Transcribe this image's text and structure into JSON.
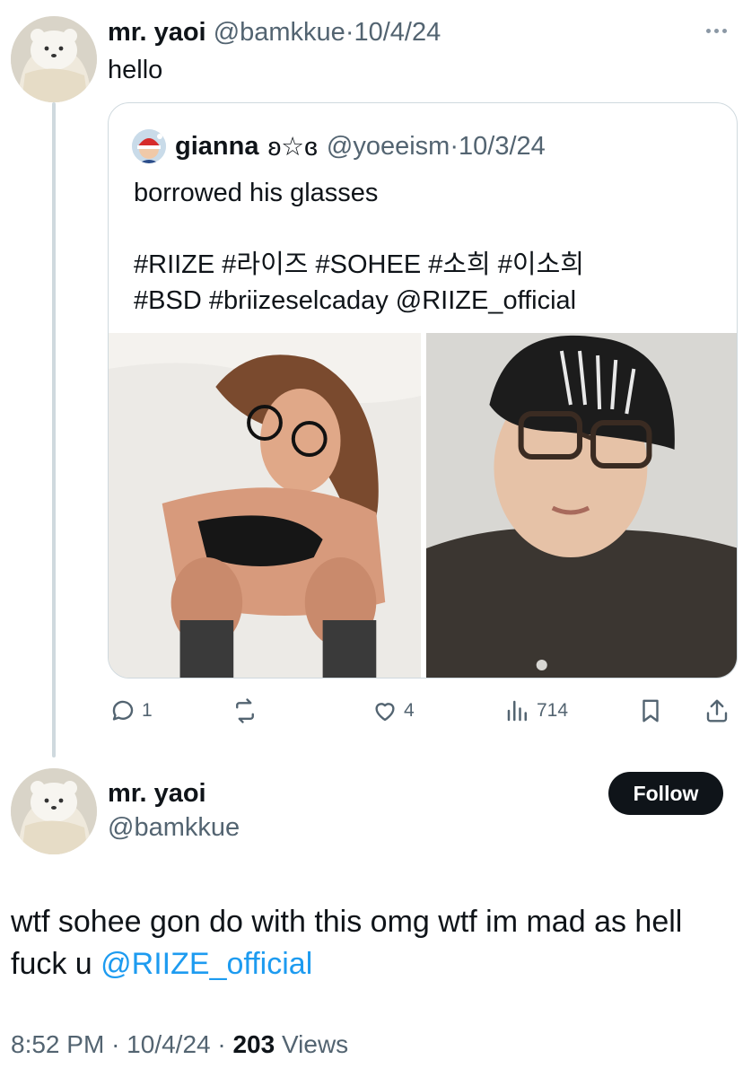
{
  "reply_tweet": {
    "author_name": "mr. yaoi",
    "author_handle": "@bamkkue",
    "separator": "·",
    "date": "10/4/24",
    "text": "hello",
    "more_icon": "more-horizontal-icon"
  },
  "quoted_tweet": {
    "author_name": "gianna",
    "author_name_deco": "ʚ☆ɞ",
    "author_handle": "@yoeeism",
    "separator": "·",
    "date": "10/3/24",
    "text_line1": "borrowed his glasses",
    "hashtags_line1": "#RIIZE #라이즈 #SOHEE #소희 #이소희",
    "hashtags_line2": "#BSD #briizeselcaday @RIIZE_official",
    "images": [
      "photo-left",
      "photo-right"
    ]
  },
  "actions": {
    "replies": "1",
    "reposts": "",
    "likes": "4",
    "views": "714",
    "icons": [
      "reply-icon",
      "repost-icon",
      "like-icon",
      "views-icon",
      "bookmark-icon",
      "share-icon"
    ]
  },
  "main_tweet": {
    "author_name": "mr. yaoi",
    "author_handle": "@bamkkue",
    "follow_label": "Follow",
    "text_before_mention": "wtf sohee gon do with this omg wtf im mad as hell fuck u ",
    "mention": "@RIIZE_official",
    "time": "8:52 PM",
    "separator": "·",
    "date": "10/4/24",
    "views_count": "203",
    "views_label": "Views"
  },
  "colors": {
    "text": "#0f1419",
    "muted": "#536471",
    "link": "#1d9bf0",
    "border": "#cfd9de",
    "follow_bg": "#0f1419"
  }
}
